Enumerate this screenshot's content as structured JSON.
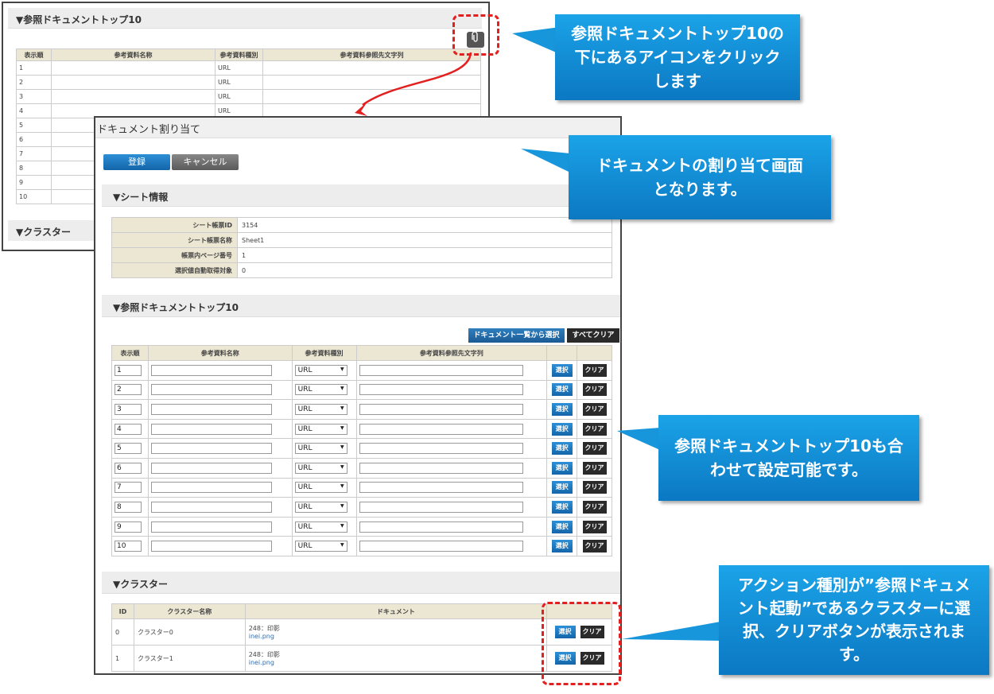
{
  "bg_window": {
    "section_title": "▼参照ドキュメントトップ10",
    "columns": [
      "表示順",
      "参考資料名称",
      "参考資料種別",
      "参考資料参照先文字列"
    ],
    "rows": [
      {
        "order": "1",
        "type": "URL"
      },
      {
        "order": "2",
        "type": "URL"
      },
      {
        "order": "3",
        "type": "URL"
      },
      {
        "order": "4",
        "type": "URL"
      },
      {
        "order": "5",
        "type": ""
      },
      {
        "order": "6",
        "type": ""
      },
      {
        "order": "7",
        "type": ""
      },
      {
        "order": "8",
        "type": ""
      },
      {
        "order": "9",
        "type": ""
      },
      {
        "order": "10",
        "type": ""
      }
    ],
    "cluster_title": "▼クラスター",
    "clip_icon": "paperclip-icon"
  },
  "dialog": {
    "title": "ドキュメント割り当て",
    "register_label": "登録",
    "cancel_label": "キャンセル",
    "sheet_section": "▼シート情報",
    "sheet_info": [
      {
        "label": "シート帳票ID",
        "value": "3154"
      },
      {
        "label": "シート帳票名称",
        "value": "Sheet1"
      },
      {
        "label": "帳票内ページ番号",
        "value": "1"
      },
      {
        "label": "選択値自動取得対象",
        "value": "0"
      }
    ],
    "ref_section": "▼参照ドキュメントトップ10",
    "doclist_label": "ドキュメント一覧から選択",
    "allclear_label": "すべてクリア",
    "ref_columns": [
      "表示順",
      "参考資料名称",
      "参考資料種別",
      "参考資料参照先文字列",
      "",
      ""
    ],
    "ref_rows": [
      {
        "order": "1",
        "type": "URL"
      },
      {
        "order": "2",
        "type": "URL"
      },
      {
        "order": "3",
        "type": "URL"
      },
      {
        "order": "4",
        "type": "URL"
      },
      {
        "order": "5",
        "type": "URL"
      },
      {
        "order": "6",
        "type": "URL"
      },
      {
        "order": "7",
        "type": "URL"
      },
      {
        "order": "8",
        "type": "URL"
      },
      {
        "order": "9",
        "type": "URL"
      },
      {
        "order": "10",
        "type": "URL"
      }
    ],
    "select_label": "選択",
    "clear_label": "クリア",
    "cluster_section": "▼クラスター",
    "cluster_columns": [
      "ID",
      "クラスター名称",
      "ドキュメント",
      ""
    ],
    "cluster_rows": [
      {
        "id": "0",
        "name": "クラスター0",
        "doc": "248：印影",
        "file": "inei.png"
      },
      {
        "id": "1",
        "name": "クラスター1",
        "doc": "248：印影",
        "file": "inei.png"
      }
    ]
  },
  "callouts": {
    "c1": "参照ドキュメントトップ10の下にあるアイコンをクリックします",
    "c2": "ドキュメントの割り当て画面となります。",
    "c3": "参照ドキュメントトップ10も合わせて設定可能です。",
    "c4": "アクション種別が”参照ドキュメント起動”であるクラスターに選択、クリアボタンが表示されます。"
  },
  "colors": {
    "callout": "#1192d8",
    "highlight": "#e32020",
    "header_bg": "#ece7d2"
  }
}
